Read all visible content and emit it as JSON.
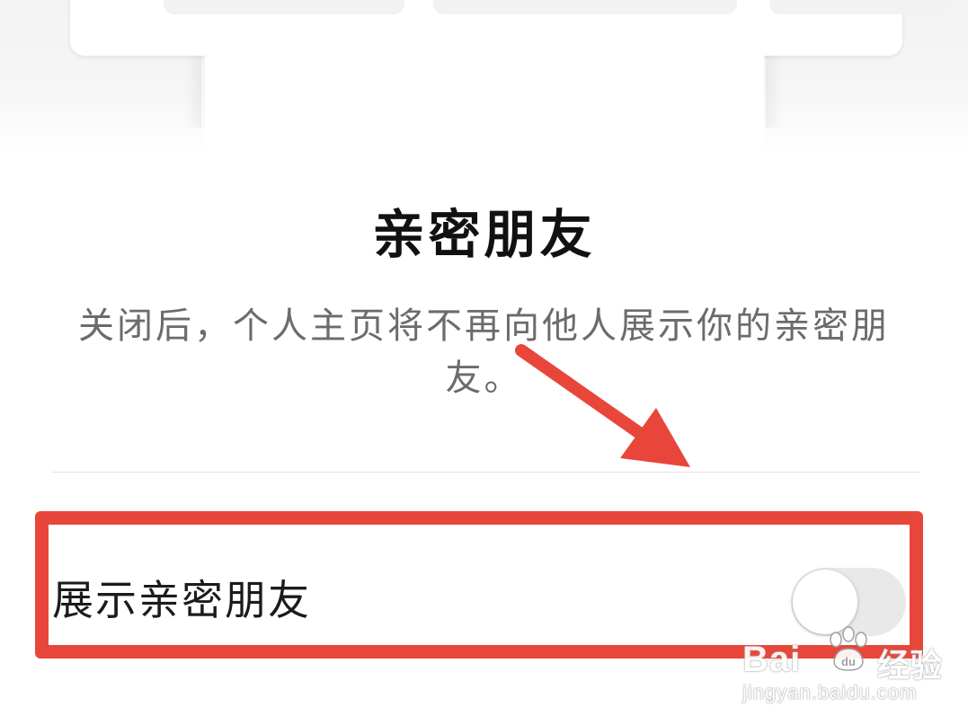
{
  "dialog": {
    "title": "亲密朋友",
    "description": "关闭后，个人主页将不再向他人展示你的亲密朋友。"
  },
  "setting_row": {
    "label": "展示亲密朋友",
    "toggle_on": false
  },
  "watermark": {
    "logo_text": "Bai",
    "logo_suffix": "经验",
    "url": "jingyan.baidu.com"
  },
  "colors": {
    "annotation_red": "#e8463a",
    "toggle_off_track": "#e9e9e9",
    "description_gray": "#6b6b6b"
  }
}
